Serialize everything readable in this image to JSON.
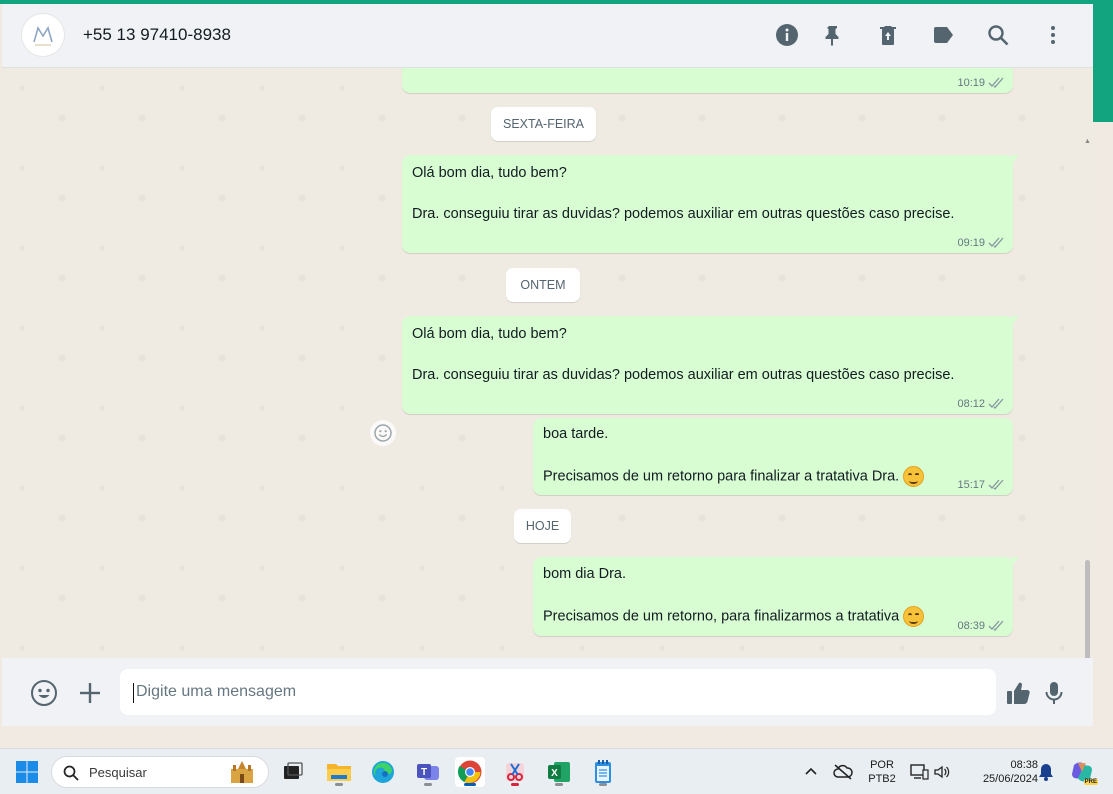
{
  "header": {
    "contact_name": "+55 13 97410-8938",
    "icons": [
      "info-icon",
      "pin-icon",
      "delete-icon",
      "label-icon",
      "search-icon",
      "menu-icon"
    ]
  },
  "messages": [
    {
      "type": "partial",
      "time": "10:19"
    },
    {
      "type": "day",
      "label": "SEXTA-FEIRA"
    },
    {
      "type": "out",
      "line1": "Olá bom dia, tudo bem?",
      "line2": "Dra. conseguiu tirar as duvidas? podemos auxiliar em outras questões caso precise.",
      "time": "09:19"
    },
    {
      "type": "day",
      "label": "ONTEM"
    },
    {
      "type": "out",
      "line1": "Olá bom dia, tudo bem?",
      "line2": "Dra. conseguiu tirar as duvidas? podemos auxiliar em outras questões caso precise.",
      "time": "08:12"
    },
    {
      "type": "out",
      "line1": "boa tarde.",
      "line2": "Precisamos de um retorno para finalizar a tratativa Dra.",
      "time": "15:17"
    },
    {
      "type": "day",
      "label": "HOJE"
    },
    {
      "type": "out",
      "line1": "bom dia Dra.",
      "line2": "Precisamos de um retorno, para finalizarmos a tratativa",
      "time": "08:39"
    }
  ],
  "composer": {
    "placeholder": "Digite uma mensagem",
    "value": ""
  },
  "taskbar": {
    "search_placeholder": "Pesquisar",
    "lang_line1": "POR",
    "lang_line2": "PTB2",
    "clock_time": "08:38",
    "clock_date": "25/06/2024",
    "copilot_badge": "PRE"
  },
  "colors": {
    "accent": "#12a37f",
    "outgoing_bubble": "#d9fdd3",
    "chat_background": "#efeae2",
    "header_background": "#f0f2f5",
    "read_ticks": "#8696a0"
  }
}
